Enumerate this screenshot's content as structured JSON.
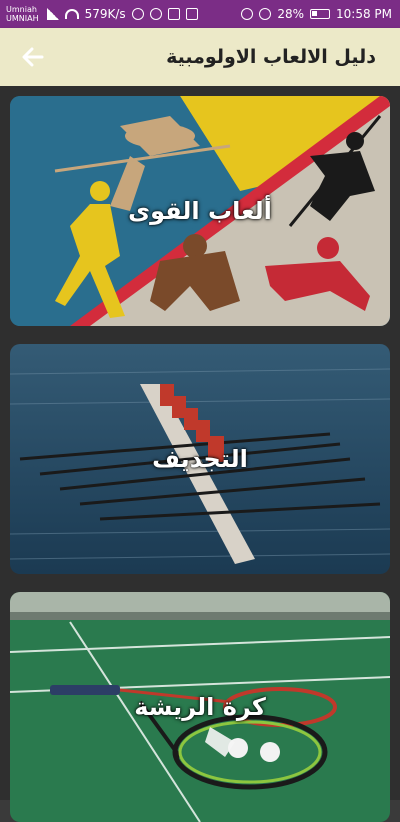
{
  "status_bar": {
    "carrier_top": "Umniah",
    "carrier_bottom": "UMNIAH",
    "speed": "579K/s",
    "battery": "28%",
    "time": "10:58 PM"
  },
  "app_bar": {
    "title": "دليل الالعاب الاولومبية",
    "back_icon": "arrow-left-icon"
  },
  "categories": [
    {
      "label": "ألعاب القوى"
    },
    {
      "label": "التجديف"
    },
    {
      "label": "كرة الريشة"
    }
  ]
}
